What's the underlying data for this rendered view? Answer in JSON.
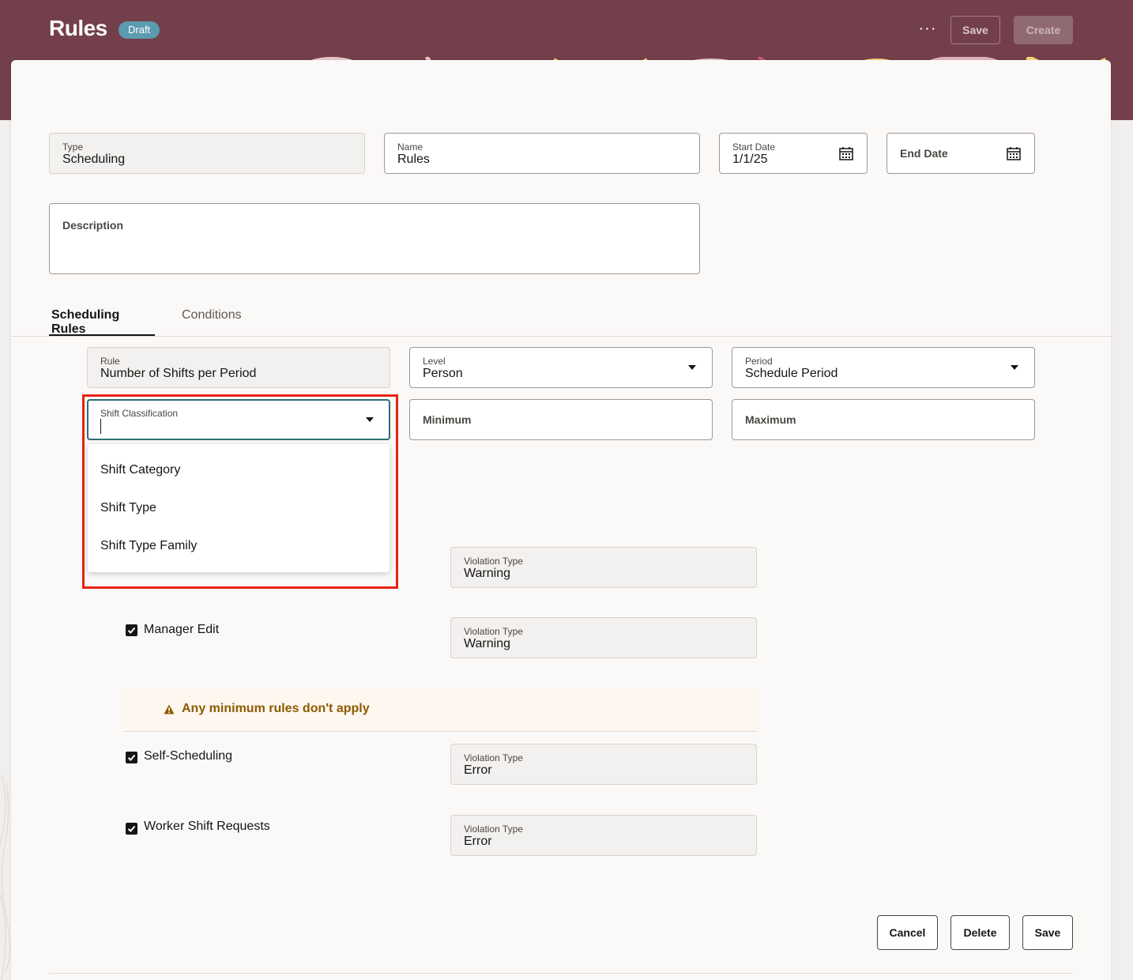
{
  "header": {
    "title": "Rules",
    "badge": "Draft",
    "more_label": "···",
    "save_label": "Save",
    "create_label": "Create"
  },
  "form": {
    "type": {
      "label": "Type",
      "value": "Scheduling"
    },
    "name": {
      "label": "Name",
      "value": "Rules"
    },
    "start_date": {
      "label": "Start Date",
      "value": "1/1/25"
    },
    "end_date": {
      "placeholder": "End Date"
    },
    "description": {
      "placeholder": "Description"
    }
  },
  "tabs": [
    {
      "label": "Scheduling Rules",
      "active": true
    },
    {
      "label": "Conditions",
      "active": false
    }
  ],
  "rule_fields": {
    "rule": {
      "label": "Rule",
      "value": "Number of Shifts per Period"
    },
    "level": {
      "label": "Level",
      "value": "Person"
    },
    "period": {
      "label": "Period",
      "value": "Schedule Period"
    },
    "shift_classification": {
      "label": "Shift Classification",
      "value": ""
    },
    "minimum": {
      "placeholder": "Minimum"
    },
    "maximum": {
      "placeholder": "Maximum"
    }
  },
  "dropdown_options": [
    "Shift Category",
    "Shift Type",
    "Shift Type Family"
  ],
  "violations": [
    {
      "label": "Violation Type",
      "value": "Warning"
    },
    {
      "label": "Violation Type",
      "value": "Warning"
    },
    {
      "label": "Violation Type",
      "value": "Error"
    },
    {
      "label": "Violation Type",
      "value": "Error"
    }
  ],
  "checkboxes": [
    {
      "label": "Manager Edit",
      "checked": true
    },
    {
      "label": "Self-Scheduling",
      "checked": true
    },
    {
      "label": "Worker Shift Requests",
      "checked": true
    }
  ],
  "warning": {
    "text": "Any minimum rules don't apply",
    "icon": "warning-triangle-icon",
    "color": "#8d5a00"
  },
  "footer": {
    "cancel_label": "Cancel",
    "delete_label": "Delete",
    "save_label": "Save"
  },
  "colors": {
    "header_bg": "#733f4a",
    "badge_bg": "#5b9bb0",
    "focus_border": "#2c6e72",
    "highlight": "#e8220f"
  }
}
